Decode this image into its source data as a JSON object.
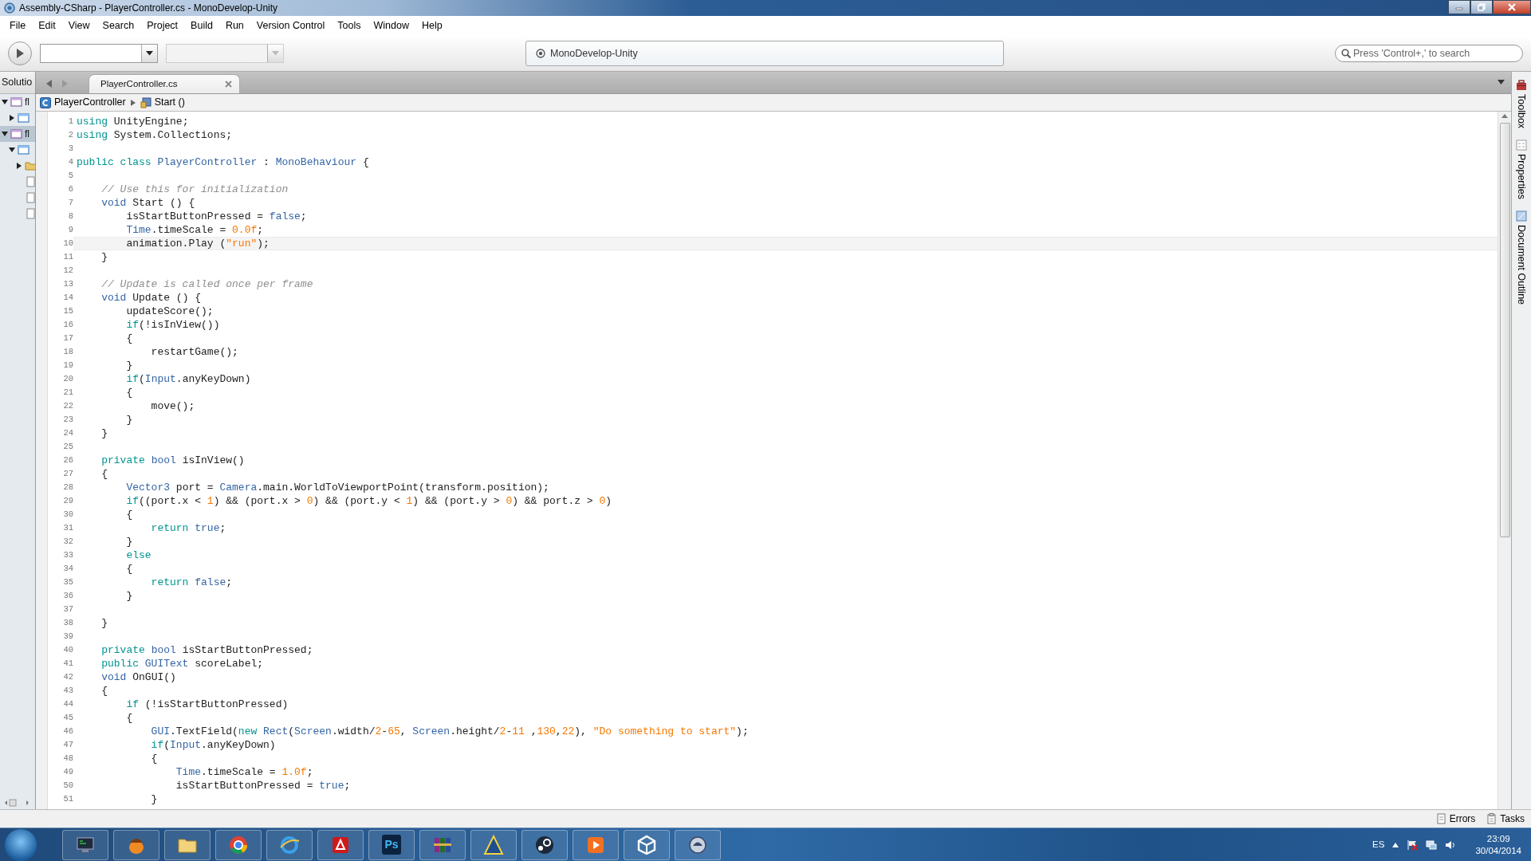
{
  "window": {
    "title": "Assembly-CSharp - PlayerController.cs - MonoDevelop-Unity"
  },
  "menu": [
    "File",
    "Edit",
    "View",
    "Search",
    "Project",
    "Build",
    "Run",
    "Version Control",
    "Tools",
    "Window",
    "Help"
  ],
  "toolbar": {
    "selectors": [
      {
        "disabled": false
      },
      {
        "disabled": true
      }
    ],
    "status": "MonoDevelop-Unity",
    "search": {
      "placeholder": "Press 'Control+,' to search"
    }
  },
  "solution_pad": {
    "title": "Solutio",
    "tree": [
      {
        "kind": "solution",
        "label": "fl",
        "expanded": true,
        "selected": false,
        "children": [
          {
            "kind": "project",
            "expanded": false,
            "selected": false
          }
        ]
      },
      {
        "kind": "solution",
        "label": "fl",
        "expanded": true,
        "selected": true,
        "children": [
          {
            "kind": "project",
            "expanded": true,
            "selected": false,
            "children": [
              {
                "kind": "folder",
                "expanded": false,
                "selected": false
              },
              {
                "kind": "file",
                "selected": false
              },
              {
                "kind": "file",
                "selected": false
              },
              {
                "kind": "file",
                "selected": false
              }
            ]
          }
        ]
      }
    ]
  },
  "tabs": [
    {
      "label": "PlayerController.cs",
      "selected": true
    }
  ],
  "breadcrumb": [
    {
      "kind": "class",
      "label": "PlayerController"
    },
    {
      "kind": "method",
      "label": "Start ()"
    }
  ],
  "editor": {
    "lines": [
      {
        "n": "1",
        "current": false,
        "tokens": [
          {
            "kind": "kw",
            "text": "using"
          },
          {
            "kind": "tx",
            "text": " UnityEngine;"
          }
        ]
      },
      {
        "n": "2",
        "current": false,
        "tokens": [
          {
            "kind": "kw",
            "text": "using"
          },
          {
            "kind": "tx",
            "text": " System.Collections;"
          }
        ]
      },
      {
        "n": "3",
        "current": false
      },
      {
        "n": "4",
        "current": false,
        "tokens": [
          {
            "kind": "kw",
            "text": "public class"
          },
          {
            "kind": "type",
            "text": " PlayerController"
          },
          {
            "kind": "tx",
            "text": " : "
          },
          {
            "kind": "type",
            "text": "MonoBehaviour"
          },
          {
            "kind": "tx",
            "text": " {"
          }
        ]
      },
      {
        "n": "5",
        "current": false
      },
      {
        "n": "6",
        "current": false,
        "tokens": [
          {
            "kind": "cm",
            "text": "    // Use this for initialization"
          }
        ]
      },
      {
        "n": "7",
        "current": false,
        "tokens": [
          {
            "kind": "type",
            "text": "    void"
          },
          {
            "kind": "tx",
            "text": " Start () {"
          }
        ]
      },
      {
        "n": "8",
        "current": false,
        "tokens": [
          {
            "kind": "tx",
            "text": "        isStartButtonPressed = "
          },
          {
            "kind": "type",
            "text": "false"
          },
          {
            "kind": "tx",
            "text": ";"
          }
        ]
      },
      {
        "n": "9",
        "current": false,
        "tokens": [
          {
            "kind": "type",
            "text": "        Time"
          },
          {
            "kind": "tx",
            "text": ".timeScale = "
          },
          {
            "kind": "num",
            "text": "0.0f"
          },
          {
            "kind": "tx",
            "text": ";"
          }
        ]
      },
      {
        "n": "10",
        "current": true,
        "tokens": [
          {
            "kind": "tx",
            "text": "        animation.Play ("
          },
          {
            "kind": "str",
            "text": "\"run\""
          },
          {
            "kind": "tx",
            "text": ");"
          }
        ]
      },
      {
        "n": "11",
        "current": false,
        "tokens": [
          {
            "kind": "tx",
            "text": "    }"
          }
        ]
      },
      {
        "n": "12",
        "current": false
      },
      {
        "n": "13",
        "current": false,
        "tokens": [
          {
            "kind": "cm",
            "text": "    // Update is called once per frame"
          }
        ]
      },
      {
        "n": "14",
        "current": false,
        "tokens": [
          {
            "kind": "type",
            "text": "    void"
          },
          {
            "kind": "tx",
            "text": " Update () {"
          }
        ]
      },
      {
        "n": "15",
        "current": false,
        "tokens": [
          {
            "kind": "tx",
            "text": "        updateScore();"
          }
        ]
      },
      {
        "n": "16",
        "current": false,
        "tokens": [
          {
            "kind": "kw",
            "text": "        if"
          },
          {
            "kind": "tx",
            "text": "(!isInView())"
          }
        ]
      },
      {
        "n": "17",
        "current": false,
        "tokens": [
          {
            "kind": "tx",
            "text": "        {"
          }
        ]
      },
      {
        "n": "18",
        "current": false,
        "tokens": [
          {
            "kind": "tx",
            "text": "            restartGame();"
          }
        ]
      },
      {
        "n": "19",
        "current": false,
        "tokens": [
          {
            "kind": "tx",
            "text": "        }"
          }
        ]
      },
      {
        "n": "20",
        "current": false,
        "tokens": [
          {
            "kind": "kw",
            "text": "        if"
          },
          {
            "kind": "tx",
            "text": "("
          },
          {
            "kind": "type",
            "text": "Input"
          },
          {
            "kind": "tx",
            "text": ".anyKeyDown)"
          }
        ]
      },
      {
        "n": "21",
        "current": false,
        "tokens": [
          {
            "kind": "tx",
            "text": "        {"
          }
        ]
      },
      {
        "n": "22",
        "current": false,
        "tokens": [
          {
            "kind": "tx",
            "text": "            move();"
          }
        ]
      },
      {
        "n": "23",
        "current": false,
        "tokens": [
          {
            "kind": "tx",
            "text": "        }"
          }
        ]
      },
      {
        "n": "24",
        "current": false,
        "tokens": [
          {
            "kind": "tx",
            "text": "    }"
          }
        ]
      },
      {
        "n": "25",
        "current": false
      },
      {
        "n": "26",
        "current": false,
        "tokens": [
          {
            "kind": "kw",
            "text": "    private"
          },
          {
            "kind": "type",
            "text": " bool"
          },
          {
            "kind": "tx",
            "text": " isInView()"
          }
        ]
      },
      {
        "n": "27",
        "current": false,
        "tokens": [
          {
            "kind": "tx",
            "text": "    {"
          }
        ]
      },
      {
        "n": "28",
        "current": false,
        "tokens": [
          {
            "kind": "type",
            "text": "        Vector3"
          },
          {
            "kind": "tx",
            "text": " port = "
          },
          {
            "kind": "type",
            "text": "Camera"
          },
          {
            "kind": "tx",
            "text": ".main.WorldToViewportPoint(transform.position);"
          }
        ]
      },
      {
        "n": "29",
        "current": false,
        "tokens": [
          {
            "kind": "kw",
            "text": "        if"
          },
          {
            "kind": "tx",
            "text": "((port.x < "
          },
          {
            "kind": "num",
            "text": "1"
          },
          {
            "kind": "tx",
            "text": ") && (port.x > "
          },
          {
            "kind": "num",
            "text": "0"
          },
          {
            "kind": "tx",
            "text": ") && (port.y < "
          },
          {
            "kind": "num",
            "text": "1"
          },
          {
            "kind": "tx",
            "text": ") && (port.y > "
          },
          {
            "kind": "num",
            "text": "0"
          },
          {
            "kind": "tx",
            "text": ") && port.z > "
          },
          {
            "kind": "num",
            "text": "0"
          },
          {
            "kind": "tx",
            "text": ")"
          }
        ]
      },
      {
        "n": "30",
        "current": false,
        "tokens": [
          {
            "kind": "tx",
            "text": "        {"
          }
        ]
      },
      {
        "n": "31",
        "current": false,
        "tokens": [
          {
            "kind": "kw",
            "text": "            return"
          },
          {
            "kind": "type",
            "text": " true"
          },
          {
            "kind": "tx",
            "text": ";"
          }
        ]
      },
      {
        "n": "32",
        "current": false,
        "tokens": [
          {
            "kind": "tx",
            "text": "        }"
          }
        ]
      },
      {
        "n": "33",
        "current": false,
        "tokens": [
          {
            "kind": "kw",
            "text": "        else"
          }
        ]
      },
      {
        "n": "34",
        "current": false,
        "tokens": [
          {
            "kind": "tx",
            "text": "        {"
          }
        ]
      },
      {
        "n": "35",
        "current": false,
        "tokens": [
          {
            "kind": "kw",
            "text": "            return"
          },
          {
            "kind": "type",
            "text": " false"
          },
          {
            "kind": "tx",
            "text": ";"
          }
        ]
      },
      {
        "n": "36",
        "current": false,
        "tokens": [
          {
            "kind": "tx",
            "text": "        }"
          }
        ]
      },
      {
        "n": "37",
        "current": false
      },
      {
        "n": "38",
        "current": false,
        "tokens": [
          {
            "kind": "tx",
            "text": "    }"
          }
        ]
      },
      {
        "n": "39",
        "current": false
      },
      {
        "n": "40",
        "current": false,
        "tokens": [
          {
            "kind": "kw",
            "text": "    private"
          },
          {
            "kind": "type",
            "text": " bool"
          },
          {
            "kind": "tx",
            "text": " isStartButtonPressed;"
          }
        ]
      },
      {
        "n": "41",
        "current": false,
        "tokens": [
          {
            "kind": "kw",
            "text": "    public"
          },
          {
            "kind": "type",
            "text": " GUIText"
          },
          {
            "kind": "tx",
            "text": " scoreLabel;"
          }
        ]
      },
      {
        "n": "42",
        "current": false,
        "tokens": [
          {
            "kind": "type",
            "text": "    void"
          },
          {
            "kind": "tx",
            "text": " OnGUI()"
          }
        ]
      },
      {
        "n": "43",
        "current": false,
        "tokens": [
          {
            "kind": "tx",
            "text": "    {"
          }
        ]
      },
      {
        "n": "44",
        "current": false,
        "tokens": [
          {
            "kind": "kw",
            "text": "        if"
          },
          {
            "kind": "tx",
            "text": " (!isStartButtonPressed)"
          }
        ]
      },
      {
        "n": "45",
        "current": false,
        "tokens": [
          {
            "kind": "tx",
            "text": "        {"
          }
        ]
      },
      {
        "n": "46",
        "current": false,
        "tokens": [
          {
            "kind": "type",
            "text": "            GUI"
          },
          {
            "kind": "tx",
            "text": ".TextField("
          },
          {
            "kind": "kw",
            "text": "new"
          },
          {
            "kind": "type",
            "text": " Rect"
          },
          {
            "kind": "tx",
            "text": "("
          },
          {
            "kind": "type",
            "text": "Screen"
          },
          {
            "kind": "tx",
            "text": ".width/"
          },
          {
            "kind": "num",
            "text": "2"
          },
          {
            "kind": "tx",
            "text": "-"
          },
          {
            "kind": "num",
            "text": "65"
          },
          {
            "kind": "tx",
            "text": ", "
          },
          {
            "kind": "type",
            "text": "Screen"
          },
          {
            "kind": "tx",
            "text": ".height/"
          },
          {
            "kind": "num",
            "text": "2"
          },
          {
            "kind": "tx",
            "text": "-"
          },
          {
            "kind": "num",
            "text": "11"
          },
          {
            "kind": "tx",
            "text": " ,"
          },
          {
            "kind": "num",
            "text": "130"
          },
          {
            "kind": "tx",
            "text": ","
          },
          {
            "kind": "num",
            "text": "22"
          },
          {
            "kind": "tx",
            "text": "), "
          },
          {
            "kind": "str",
            "text": "\"Do something to start\""
          },
          {
            "kind": "tx",
            "text": ");"
          }
        ]
      },
      {
        "n": "47",
        "current": false,
        "tokens": [
          {
            "kind": "kw",
            "text": "            if"
          },
          {
            "kind": "tx",
            "text": "("
          },
          {
            "kind": "type",
            "text": "Input"
          },
          {
            "kind": "tx",
            "text": ".anyKeyDown)"
          }
        ]
      },
      {
        "n": "48",
        "current": false,
        "tokens": [
          {
            "kind": "tx",
            "text": "            {"
          }
        ]
      },
      {
        "n": "49",
        "current": false,
        "tokens": [
          {
            "kind": "type",
            "text": "                Time"
          },
          {
            "kind": "tx",
            "text": ".timeScale = "
          },
          {
            "kind": "num",
            "text": "1.0f"
          },
          {
            "kind": "tx",
            "text": ";"
          }
        ]
      },
      {
        "n": "50",
        "current": false,
        "tokens": [
          {
            "kind": "tx",
            "text": "                isStartButtonPressed = "
          },
          {
            "kind": "type",
            "text": "true"
          },
          {
            "kind": "tx",
            "text": ";"
          }
        ]
      },
      {
        "n": "51",
        "current": false,
        "tokens": [
          {
            "kind": "tx",
            "text": "            }"
          }
        ]
      }
    ]
  },
  "side_pads": [
    {
      "kind": "toolbox",
      "label": "Toolbox"
    },
    {
      "kind": "properties",
      "label": "Properties"
    },
    {
      "kind": "outline",
      "label": "Document Outline"
    }
  ],
  "status_bar": [
    {
      "kind": "errors",
      "label": "Errors"
    },
    {
      "kind": "tasks",
      "label": "Tasks"
    }
  ],
  "taskbar": {
    "apps": [
      {
        "kind": "monitor"
      },
      {
        "kind": "mascot"
      },
      {
        "kind": "folder"
      },
      {
        "kind": "chrome"
      },
      {
        "kind": "ie"
      },
      {
        "kind": "acrobat"
      },
      {
        "kind": "ps",
        "label": "Ps"
      },
      {
        "kind": "archive"
      },
      {
        "kind": "arch"
      },
      {
        "kind": "steam"
      },
      {
        "kind": "media"
      },
      {
        "kind": "unity"
      },
      {
        "kind": "mono"
      }
    ],
    "language": "ES",
    "time": "23:09",
    "date": "30/04/2014"
  }
}
